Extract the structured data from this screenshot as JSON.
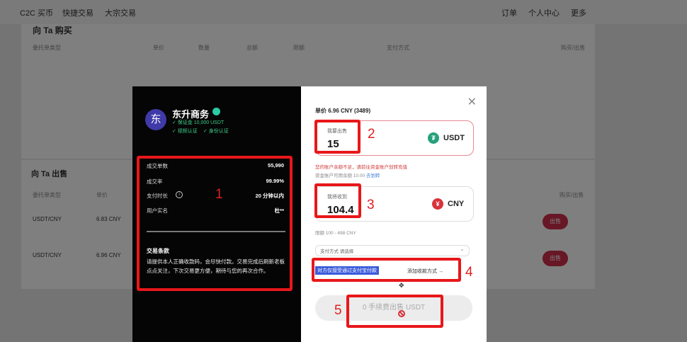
{
  "topnav": {
    "left_items": [
      "C2C 买币",
      "快捷交易",
      "大宗交易"
    ],
    "right_items": [
      "订单",
      "个人中心",
      "更多"
    ]
  },
  "buy_section": {
    "title": "向 Ta 购买",
    "headers": [
      "委托单类型",
      "单价",
      "数量",
      "总额",
      "限额",
      "支付方式",
      "购买/出售"
    ]
  },
  "sell_section": {
    "title": "向 Ta 出售",
    "headers": [
      "委托单类型",
      "单价",
      "购买/出售"
    ],
    "rows": [
      {
        "pair": "USDT/CNY",
        "price": "6.83 CNY",
        "action": "出售"
      },
      {
        "pair": "USDT/CNY",
        "price": "6.96 CNY",
        "action": "出售"
      }
    ]
  },
  "merchant": {
    "avatar_char": "东",
    "name": "东升商务",
    "deposit": "✓ 保证金 10,000 USDT",
    "badges": [
      "✓ 视频认证",
      "✓ 身份认证"
    ],
    "stats": [
      {
        "label": "成交单数",
        "value": "55,990"
      },
      {
        "label": "成交率",
        "value": "99.99%"
      },
      {
        "label": "支付时长",
        "value": "20 分钟以内"
      },
      {
        "label": "用户实名",
        "value": "杜**"
      }
    ],
    "terms_title": "交易条款",
    "terms_text": "请提供本人正确收款码，会尽快付款。交易完成后刷新老板点点关注，下次交易更方便，期待与您的再次合作。"
  },
  "order": {
    "price": "单价 6.96 CNY (3489)",
    "sell_label": "我要出售",
    "sell_value": "15",
    "sell_currency": "USDT",
    "error_text": "您的账户余额不足，请前往资金账户划转充值",
    "available_text": "资金账户可用余额 10.00",
    "available_link": "去划转",
    "receive_label": "我将收到",
    "receive_value": "104.4",
    "receive_currency": "CNY",
    "limit_text": "限额 100 - 498 CNY",
    "payment_select": "支付方式  请选择",
    "payment_strip": "对方仅接受通过支付宝付款",
    "add_payment": "添加收款方式 →",
    "submit_label": "0 手续费出售 USDT"
  },
  "annotations": [
    "1",
    "2",
    "3",
    "4",
    "5"
  ],
  "colors": {
    "accent_red": "#e8171a",
    "sell_btn": "#cf2e4b",
    "usdt": "#26a17b",
    "cny": "#d9323b"
  }
}
